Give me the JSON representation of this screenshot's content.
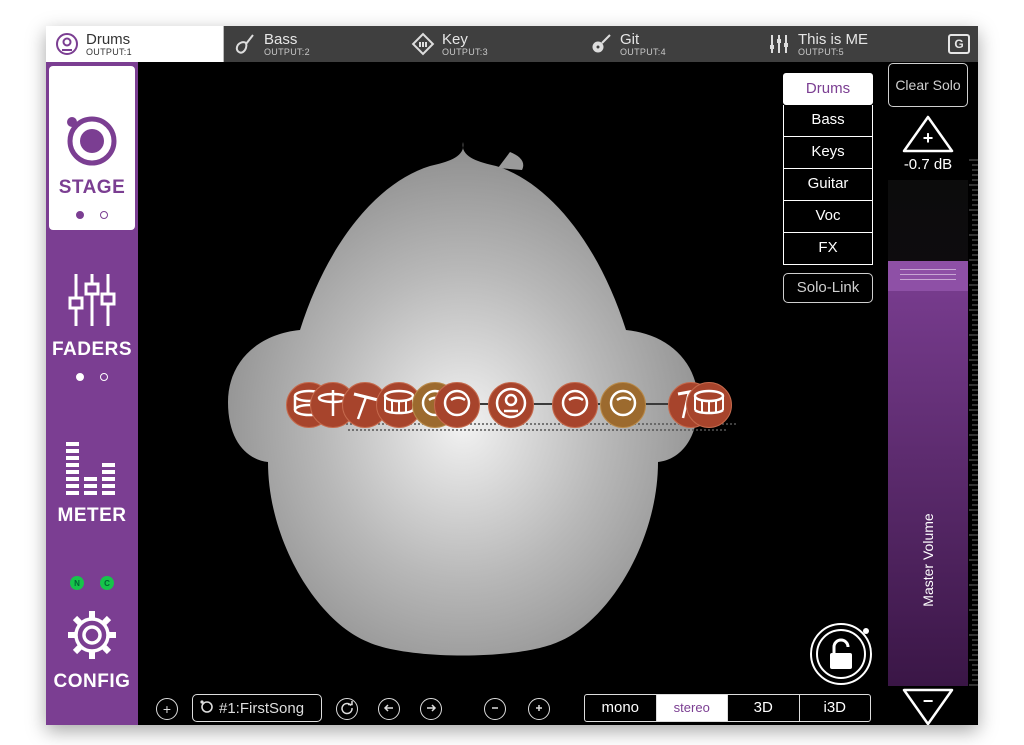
{
  "tabs": [
    {
      "name": "Drums",
      "output": "OUTPUT:1",
      "icon": "drum-kit-icon",
      "active": true
    },
    {
      "name": "Bass",
      "output": "OUTPUT:2",
      "icon": "bass-guitar-icon",
      "active": false
    },
    {
      "name": "Key",
      "output": "OUTPUT:3",
      "icon": "keyboard-icon",
      "active": false
    },
    {
      "name": "Git",
      "output": "OUTPUT:4",
      "icon": "guitar-icon",
      "active": false
    },
    {
      "name": "This is ME",
      "output": "OUTPUT:5",
      "icon": "mixer-icon",
      "active": false
    }
  ],
  "header": {
    "g_button": "G"
  },
  "sidebar": {
    "stage": "STAGE",
    "faders": "FADERS",
    "meter": "METER",
    "config": "CONFIG",
    "leds": [
      "N",
      "C"
    ]
  },
  "groups": {
    "items": [
      "Drums",
      "Bass",
      "Keys",
      "Guitar",
      "Voc",
      "FX"
    ],
    "active": "Drums",
    "solo_link": "Solo-Link"
  },
  "master": {
    "clear_solo": "Clear Solo",
    "up": "+",
    "down": "−",
    "db": "-0.7 dB",
    "label": "Master Volume",
    "level": 0.84
  },
  "stage_sources": [
    {
      "icon": "floor-tom-icon",
      "color": "rust"
    },
    {
      "icon": "hihat-icon",
      "color": "rust"
    },
    {
      "icon": "cymbal-icon",
      "color": "rust"
    },
    {
      "icon": "snare-icon",
      "color": "rust"
    },
    {
      "icon": "tom-icon",
      "color": "gold"
    },
    {
      "icon": "tom-icon",
      "color": "rust"
    },
    {
      "icon": "kick-drum-icon",
      "color": "rust"
    },
    {
      "icon": "tom-icon",
      "color": "rust"
    },
    {
      "icon": "tom-icon",
      "color": "gold"
    },
    {
      "icon": "ride-icon",
      "color": "rust"
    },
    {
      "icon": "floor-tom-icon",
      "color": "rust"
    }
  ],
  "colors": {
    "accent": "#7b3e92",
    "source": "#a7442c",
    "source_alt": "#9c6a2e"
  },
  "bottom": {
    "song": "#1:FirstSong",
    "add": "+",
    "modes": [
      "mono",
      "stereo",
      "3D",
      "i3D"
    ],
    "active_mode": "stereo"
  }
}
